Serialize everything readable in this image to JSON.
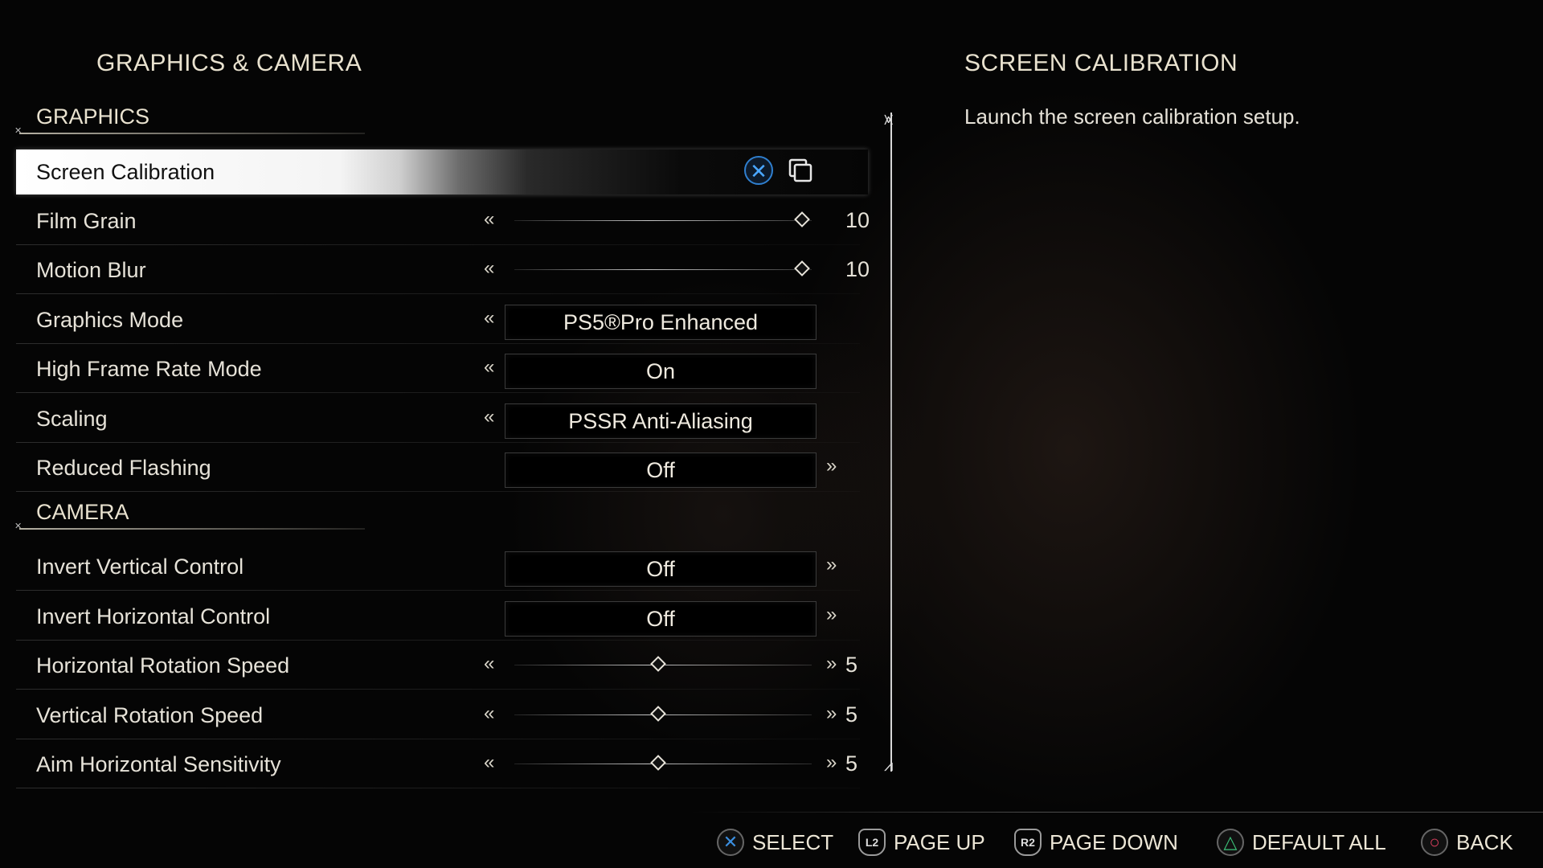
{
  "page_title": "GRAPHICS & CAMERA",
  "sections": {
    "graphics_label": "GRAPHICS",
    "camera_label": "CAMERA"
  },
  "rows": {
    "screen_calibration": {
      "label": "Screen Calibration"
    },
    "film_grain": {
      "label": "Film Grain",
      "value": "10",
      "fraction": 1.0
    },
    "motion_blur": {
      "label": "Motion Blur",
      "value": "10",
      "fraction": 1.0
    },
    "graphics_mode": {
      "label": "Graphics Mode",
      "value": "PS5®Pro Enhanced"
    },
    "high_frame_rate": {
      "label": "High Frame Rate Mode",
      "value": "On"
    },
    "scaling": {
      "label": "Scaling",
      "value": "PSSR Anti-Aliasing"
    },
    "reduced_flashing": {
      "label": "Reduced Flashing",
      "value": "Off"
    },
    "invert_vertical": {
      "label": "Invert Vertical Control",
      "value": "Off"
    },
    "invert_horizontal": {
      "label": "Invert Horizontal Control",
      "value": "Off"
    },
    "horizontal_rotation": {
      "label": "Horizontal Rotation Speed",
      "value": "5",
      "fraction": 0.5
    },
    "vertical_rotation": {
      "label": "Vertical Rotation Speed",
      "value": "5",
      "fraction": 0.5
    },
    "aim_horizontal": {
      "label": "Aim Horizontal Sensitivity",
      "value": "5",
      "fraction": 0.5
    }
  },
  "arrows": {
    "left": "«",
    "right": "»"
  },
  "detail": {
    "title": "SCREEN CALIBRATION",
    "description": "Launch the screen calibration setup."
  },
  "hints": {
    "select": {
      "glyph": "✕",
      "label": "SELECT",
      "color": "#3b8fe0"
    },
    "page_up": {
      "glyph": "L2",
      "label": "PAGE UP"
    },
    "page_down": {
      "glyph": "R2",
      "label": "PAGE DOWN"
    },
    "default_all": {
      "glyph": "△",
      "label": "DEFAULT ALL",
      "color": "#3dc47a"
    },
    "back": {
      "glyph": "○",
      "label": "BACK",
      "color": "#e04060"
    }
  },
  "icons": {
    "x_button": "cross-button-icon",
    "copy": "copy-icon",
    "scroll_top": "scroll-top-cap-icon",
    "scroll_bottom": "scroll-bottom-cap-icon"
  },
  "colors": {
    "accent_text": "#e9e2cf",
    "select_blue": "#3b8fe0",
    "triangle_green": "#3dc47a",
    "circle_red": "#e04060"
  }
}
